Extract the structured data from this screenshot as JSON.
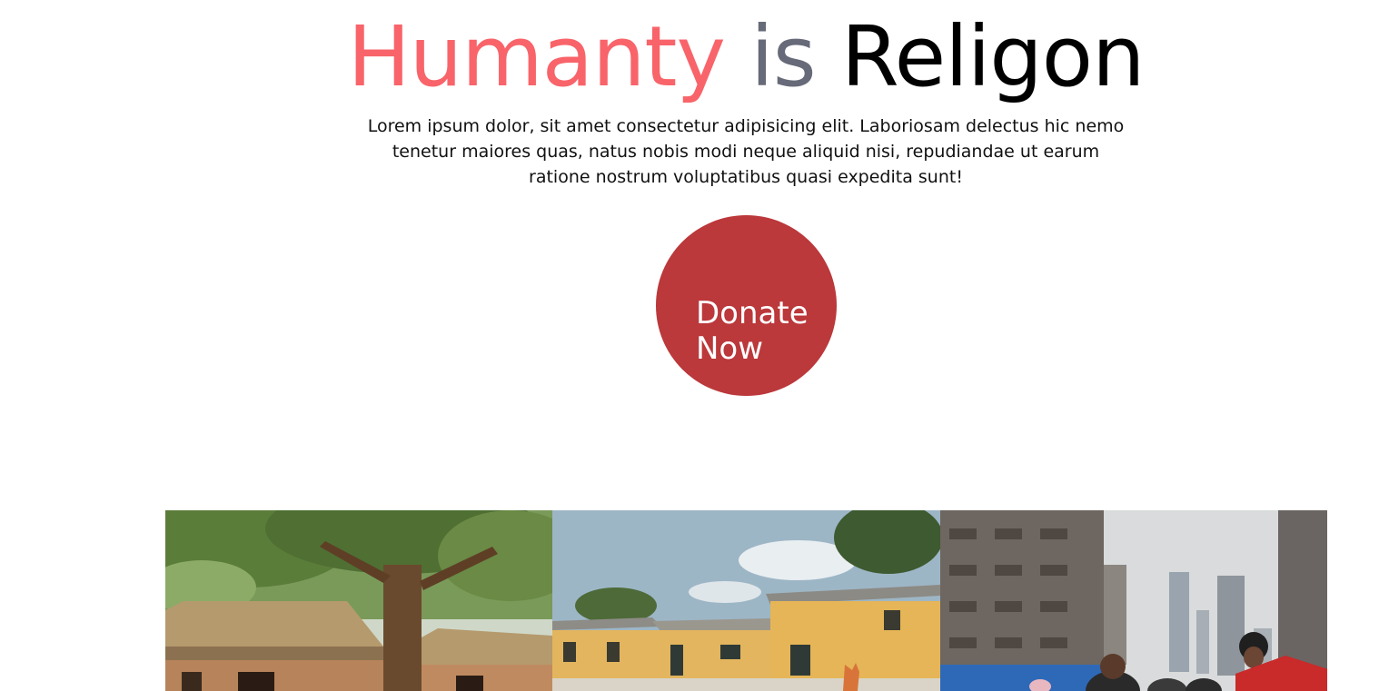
{
  "hero": {
    "title_word_1": "Humanty",
    "title_word_2": "is",
    "title_word_3": "Religon",
    "description": "Lorem ipsum dolor, sit amet consectetur adipisicing elit. Laboriosam delectus hic nemo tenetur maiores quas, natus nobis modi neque aliquid nisi, repudiandae ut earum ratione nostrum voluptatibus quasi expedita sunt!",
    "donate_line_1": "Donate",
    "donate_line_2": "Now"
  },
  "colors": {
    "title_word_1": "#f8646a",
    "title_word_2": "#676a78",
    "title_word_3": "#000000",
    "donate_button": "#bb383b"
  },
  "gallery": {
    "photos": [
      {
        "subject": "thatched-mud-hut-under-tree"
      },
      {
        "subject": "village-school-building-with-people"
      },
      {
        "subject": "city-street-relief-distribution"
      }
    ]
  }
}
